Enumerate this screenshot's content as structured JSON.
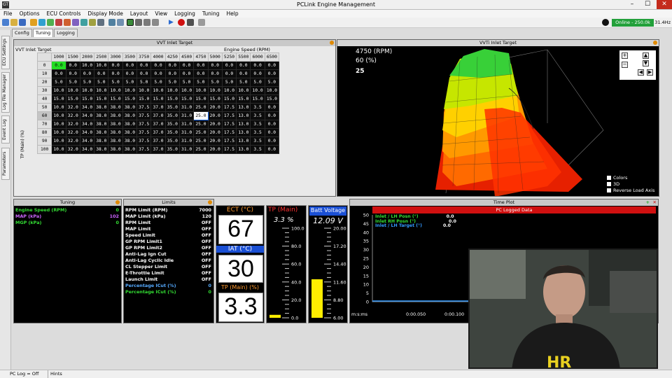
{
  "window": {
    "title": "PCLink Engine Management",
    "app_icon": "GT"
  },
  "menu": [
    "File",
    "Options",
    "ECU Controls",
    "Display Mode",
    "Layout",
    "View",
    "Logging",
    "Tuning",
    "Help"
  ],
  "status": {
    "online": "Online - 250.0k",
    "rate": "31.4Hz"
  },
  "tabs": [
    "Config",
    "Tuning",
    "Logging"
  ],
  "side_tabs": [
    "ECU Settings",
    "Log File Manager",
    "Event Log",
    "Parameters"
  ],
  "table": {
    "pane_title": "VVT Inlet Target",
    "title": "VVT Inlet Target",
    "x_axis_label": "Engine Speed (RPM)",
    "y_axis_label": "TP (Main) (%)",
    "cols": [
      "1000",
      "1500",
      "2000",
      "2500",
      "3000",
      "3500",
      "3750",
      "4000",
      "4250",
      "4500",
      "4750",
      "5000",
      "5250",
      "5500",
      "6000",
      "6500"
    ],
    "rows": [
      {
        "h": "0",
        "v": [
          "0.0",
          "0.0",
          "10.0",
          "10.0",
          "0.0",
          "0.0",
          "0.0",
          "0.0",
          "0.0",
          "0.0",
          "0.0",
          "0.0",
          "0.0",
          "0.0",
          "0.0",
          "0.0"
        ]
      },
      {
        "h": "10",
        "v": [
          "0.0",
          "0.0",
          "0.0",
          "0.0",
          "0.0",
          "0.0",
          "0.0",
          "0.0",
          "0.0",
          "0.0",
          "0.0",
          "0.0",
          "0.0",
          "0.0",
          "0.0",
          "0.0"
        ]
      },
      {
        "h": "20",
        "v": [
          "5.0",
          "5.0",
          "5.0",
          "5.0",
          "5.0",
          "5.0",
          "5.0",
          "5.0",
          "5.0",
          "5.0",
          "5.0",
          "5.0",
          "5.0",
          "5.0",
          "5.0",
          "5.0"
        ]
      },
      {
        "h": "30",
        "v": [
          "10.0",
          "10.0",
          "10.0",
          "10.0",
          "10.0",
          "10.0",
          "10.0",
          "10.0",
          "10.0",
          "10.0",
          "10.0",
          "10.0",
          "10.0",
          "10.0",
          "10.0",
          "10.0"
        ]
      },
      {
        "h": "40",
        "v": [
          "15.0",
          "15.0",
          "15.0",
          "15.0",
          "15.0",
          "15.0",
          "15.0",
          "15.0",
          "15.0",
          "15.0",
          "15.0",
          "15.0",
          "15.0",
          "15.0",
          "15.0",
          "15.0"
        ]
      },
      {
        "h": "50",
        "v": [
          "10.0",
          "32.0",
          "34.0",
          "38.0",
          "38.0",
          "38.0",
          "37.5",
          "37.0",
          "35.0",
          "31.0",
          "25.0",
          "20.0",
          "17.5",
          "13.0",
          "3.5",
          "0.0"
        ]
      },
      {
        "h": "60",
        "v": [
          "10.0",
          "32.0",
          "34.0",
          "38.0",
          "38.0",
          "38.0",
          "37.5",
          "37.0",
          "35.0",
          "31.0",
          "25.0",
          "20.0",
          "17.5",
          "13.0",
          "3.5",
          "0.0"
        ]
      },
      {
        "h": "70",
        "v": [
          "10.0",
          "32.0",
          "34.0",
          "38.0",
          "38.0",
          "38.0",
          "37.5",
          "37.0",
          "35.0",
          "31.0",
          "25.0",
          "20.0",
          "17.5",
          "13.0",
          "3.5",
          "0.0"
        ]
      },
      {
        "h": "80",
        "v": [
          "10.0",
          "32.0",
          "34.0",
          "38.0",
          "38.0",
          "38.0",
          "37.5",
          "37.0",
          "35.0",
          "31.0",
          "25.0",
          "20.0",
          "17.5",
          "13.0",
          "3.5",
          "0.0"
        ]
      },
      {
        "h": "90",
        "v": [
          "10.0",
          "32.0",
          "34.0",
          "38.0",
          "38.0",
          "38.0",
          "37.5",
          "37.0",
          "35.0",
          "31.0",
          "25.0",
          "20.0",
          "17.5",
          "13.0",
          "3.5",
          "0.0"
        ]
      },
      {
        "h": "100",
        "v": [
          "10.0",
          "32.0",
          "34.0",
          "38.0",
          "38.0",
          "38.0",
          "37.5",
          "37.0",
          "35.0",
          "31.0",
          "25.0",
          "20.0",
          "17.5",
          "13.0",
          "3.5",
          "0.0"
        ]
      }
    ]
  },
  "graph": {
    "title": "VVTi Inlet Target",
    "rpm": "4750 (RPM)",
    "load": "60 (%)",
    "value": "25",
    "colors_label": "Colors",
    "threed_label": "3D",
    "reverse_label": "Reverse Load Axis"
  },
  "tuning": {
    "title": "Tuning",
    "items": [
      {
        "label": "Engine Speed (RPM)",
        "value": "0",
        "color": "#33dd33"
      },
      {
        "label": "MAP (kPa)",
        "value": "102",
        "color": "#cc66ff"
      },
      {
        "label": "MGP (kPa)",
        "value": "0",
        "color": "#33dd33"
      }
    ]
  },
  "limits": {
    "title": "Limits",
    "items": [
      {
        "label": "RPM Limit (RPM)",
        "value": "7000",
        "color": "#ffffff"
      },
      {
        "label": "MAP Limit (kPa)",
        "value": "120",
        "color": "#ffffff"
      },
      {
        "label": "RPM Limit",
        "value": "OFF",
        "color": "#ffffff"
      },
      {
        "label": "MAP Limit",
        "value": "OFF",
        "color": "#ffffff"
      },
      {
        "label": "Speed Limit",
        "value": "OFF",
        "color": "#ffffff"
      },
      {
        "label": "GP RPM Limit1",
        "value": "OFF",
        "color": "#ffffff"
      },
      {
        "label": "GP RPM Limit2",
        "value": "OFF",
        "color": "#ffffff"
      },
      {
        "label": "Anti-Lag Ign Cut",
        "value": "OFF",
        "color": "#ffffff"
      },
      {
        "label": "Anti-Lag Cyclic Idle",
        "value": "OFF",
        "color": "#ffffff"
      },
      {
        "label": "CL Stepper Limit",
        "value": "OFF",
        "color": "#ffffff"
      },
      {
        "label": "E-Throttle Limit",
        "value": "OFF",
        "color": "#ffffff"
      },
      {
        "label": "Launch Limit",
        "value": "OFF",
        "color": "#ffffff"
      },
      {
        "label": "Percentage ICut (%)",
        "value": "0",
        "color": "#55aaff"
      },
      {
        "label": "Percentage ICut (%)",
        "value": "0",
        "color": "#33dd33"
      }
    ]
  },
  "gauges": {
    "ect": {
      "label": "ECT (°C)",
      "value": "67"
    },
    "iat": {
      "label": "IAT (°C)",
      "value": "30"
    },
    "tp": {
      "label": "TP (Main) (%)",
      "value": "3.3"
    },
    "tp_bar": {
      "label": "TP (Main)",
      "value": "3.3 %",
      "ticks": [
        "100.0",
        "80.0",
        "60.0",
        "40.0",
        "20.0",
        "0.0"
      ],
      "level": 0.033
    },
    "volt": {
      "label": "Batt Voltage",
      "value": "12.09 V",
      "ticks": [
        "20.00",
        "17.20",
        "14.40",
        "11.60",
        "8.80",
        "6.00"
      ],
      "level": 0.43
    }
  },
  "timeplot": {
    "title": "Time Plot",
    "log_label": "PC Logged Data",
    "y_ticks": [
      "50",
      "45",
      "40",
      "35",
      "30",
      "25",
      "20",
      "15",
      "10",
      "5",
      "0"
    ],
    "legend": [
      {
        "label": "Inlet / LH Posn (°)",
        "value": "0.0",
        "color": "#33dd33"
      },
      {
        "label": "Inlet RH Posn (°)",
        "value": "0.0",
        "color": "#33dd33"
      },
      {
        "label": "Inlet / LH Target (°)",
        "value": "0.0",
        "color": "#3399ff"
      }
    ],
    "x_ticks": [
      "m:s:ms",
      "0:00.050",
      "0:00.100"
    ]
  },
  "statusbar": {
    "log": "PC Log = Off",
    "hints": "Hints"
  }
}
